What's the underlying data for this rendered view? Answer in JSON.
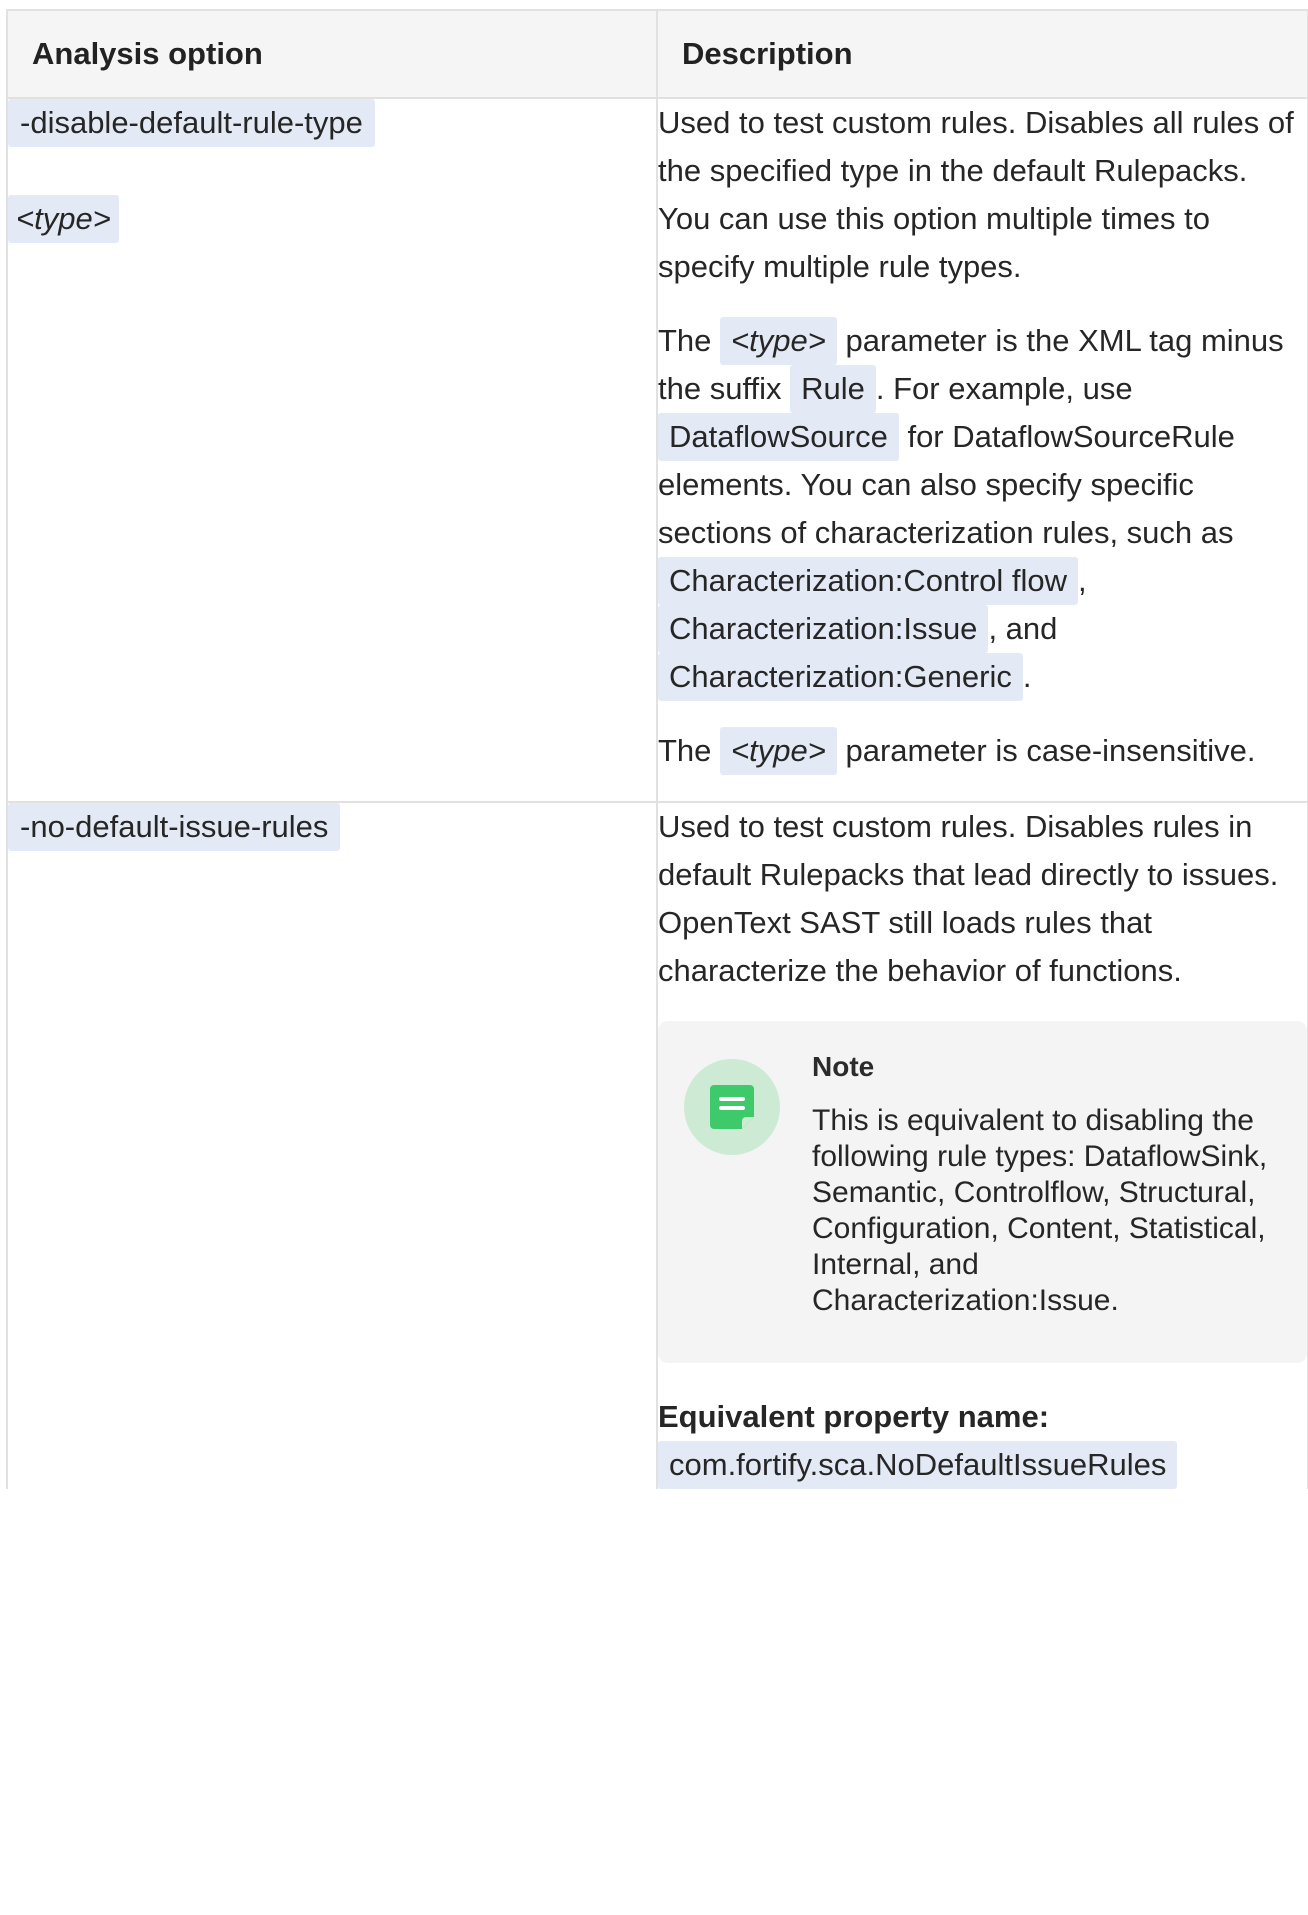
{
  "table": {
    "headers": {
      "option": "Analysis option",
      "description": "Description"
    }
  },
  "row1": {
    "option": "-disable-default-rule-type",
    "param": "<type>",
    "p1": "Used to test custom rules. Disables all rules of the specified type in the default Rulepacks. You can use this option multiple times to specify multiple rule types.",
    "p2_t1": "The ",
    "p2_c1": "<type>",
    "p2_t2": " parameter is the XML tag minus the suffix ",
    "p2_c2": "Rule",
    "p2_t3": ". For example, use ",
    "p2_c3": "DataflowSource",
    "p2_t4": " for DataflowSourceRule elements. You can also specify specific sections of characterization rules, such as ",
    "p2_c4": "Characterization:Control flow",
    "p2_t5": ", ",
    "p2_c5": "Characterization:Issue",
    "p2_t6": ", and ",
    "p2_c6": "Characterization:Generic",
    "p2_t7": ".",
    "p3_t1": "The ",
    "p3_c1": "<type>",
    "p3_t2": " parameter is case-insensitive."
  },
  "row2": {
    "option": "-no-default-issue-rules",
    "p1": "Used to test custom rules. Disables rules in default Rulepacks that lead directly to issues. OpenText SAST still loads rules that characterize the behavior of functions.",
    "note": {
      "icon": "note-icon",
      "title": "Note",
      "body": "This is equivalent to disabling the following rule types: DataflowSink, Semantic, Controlflow, Structural, Configuration, Content, Statistical, Internal, and Characterization:Issue."
    },
    "eq_label": "Equivalent property name:",
    "eq_value": "com.fortify.sca.NoDefaultIssueRules"
  },
  "colors": {
    "code_bg": "#e3eaf6",
    "header_bg": "#f5f5f5",
    "border": "#e1e1e1",
    "note_bg": "#f4f4f4",
    "note_icon": "#3ec96a"
  }
}
